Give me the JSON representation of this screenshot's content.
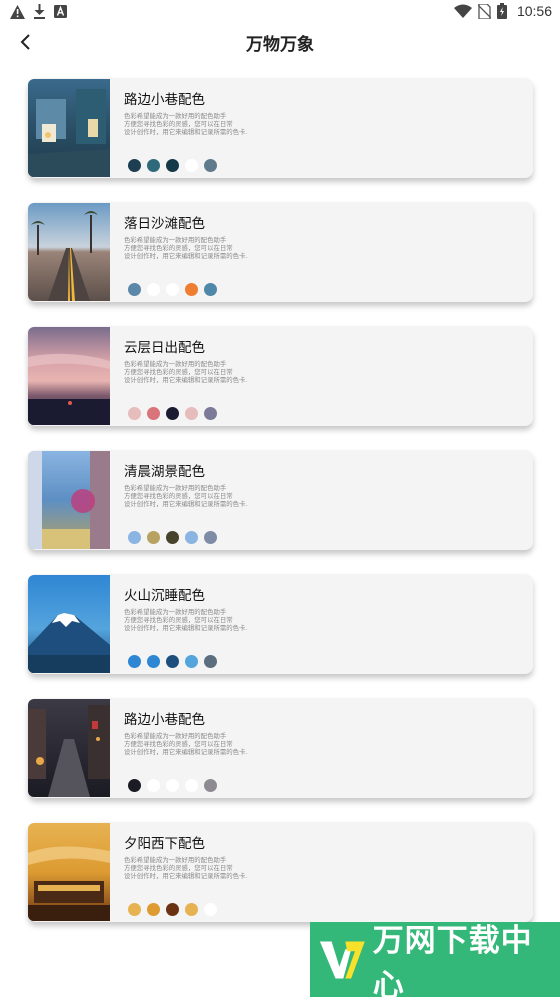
{
  "status_bar": {
    "time": "10:56",
    "icons": [
      "warning-icon",
      "download-icon",
      "a-box-icon",
      "wifi-icon",
      "no-sim-icon",
      "battery-icon"
    ]
  },
  "header": {
    "title": "万物万象",
    "back_icon": "chevron-left-icon"
  },
  "cards": [
    {
      "title": "路边小巷配色",
      "desc_lines": [
        "色彩希望能成为一款好用的配色助手",
        "方便您寻找色彩的灵感，您可以在日常",
        "设计创作时，用它来编辑和记录所需的色卡."
      ],
      "palette": [
        "#1e3e52",
        "#2e6a7a",
        "#133948",
        "#ffffff",
        "#5f7b8b"
      ]
    },
    {
      "title": "落日沙滩配色",
      "desc_lines": [
        "色彩希望能成为一款好用的配色助手",
        "方便您寻找色彩的灵感，您可以在日常",
        "设计创作时，用它来编辑和记录所需的色卡."
      ],
      "palette": [
        "#5b88a8",
        "#ffffff",
        "#ffffff",
        "#ef7d32",
        "#4f87a9"
      ]
    },
    {
      "title": "云层日出配色",
      "desc_lines": [
        "色彩希望能成为一款好用的配色助手",
        "方便您寻找色彩的灵感，您可以在日常",
        "设计创作时，用它来编辑和记录所需的色卡."
      ],
      "palette": [
        "#e6bcbc",
        "#d9757a",
        "#1a1a30",
        "#e6bcbc",
        "#7c7a99"
      ]
    },
    {
      "title": "清晨湖景配色",
      "desc_lines": [
        "色彩希望能成为一款好用的配色助手",
        "方便您寻找色彩的灵感，您可以在日常",
        "设计创作时，用它来编辑和记录所需的色卡."
      ],
      "palette": [
        "#8ab4e1",
        "#b8a261",
        "#47422a",
        "#8ab4e1",
        "#7e8ca6"
      ]
    },
    {
      "title": "火山沉睡配色",
      "desc_lines": [
        "色彩希望能成为一款好用的配色助手",
        "方便您寻找色彩的灵感，您可以在日常",
        "设计创作时，用它来编辑和记录所需的色卡."
      ],
      "palette": [
        "#2f86d3",
        "#2f86d3",
        "#1d4e7e",
        "#54a4dd",
        "#5a6e80"
      ]
    },
    {
      "title": "路边小巷配色",
      "desc_lines": [
        "色彩希望能成为一款好用的配色助手",
        "方便您寻找色彩的灵感，您可以在日常",
        "设计创作时，用它来编辑和记录所需的色卡."
      ],
      "palette": [
        "#1b1b24",
        "#ffffff",
        "#ffffff",
        "#ffffff",
        "#8d8a92"
      ]
    },
    {
      "title": "夕阳西下配色",
      "desc_lines": [
        "色彩希望能成为一款好用的配色助手",
        "方便您寻找色彩的灵感，您可以在日常",
        "设计创作时，用它来编辑和记录所需的色卡."
      ],
      "palette": [
        "#e7b252",
        "#dd9b32",
        "#6b3212",
        "#e7b252",
        "#ffffff"
      ]
    }
  ],
  "watermark": {
    "text": "万网下载中心",
    "brand_color": "#34b879"
  }
}
